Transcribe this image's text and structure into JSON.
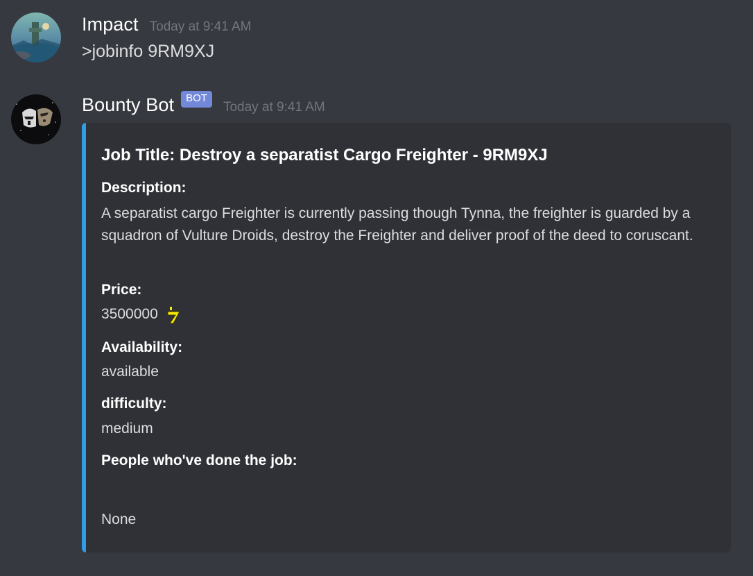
{
  "messages": [
    {
      "username": "Impact",
      "timestamp": "Today at 9:41 AM",
      "text": ">jobinfo 9RM9XJ",
      "avatar_icon": "landscape-avatar-icon"
    },
    {
      "username": "Bounty Bot",
      "bot_tag": "BOT",
      "timestamp": "Today at 9:41 AM",
      "avatar_icon": "clone-trooper-avatar-icon",
      "embed": {
        "accent_color": "#2f9de8",
        "title": "Job Title: Destroy a separatist Cargo Freighter - 9RM9XJ",
        "fields": [
          {
            "name": "Description:",
            "value": "A separatist cargo Freighter is currently passing though Tynna, the freighter is guarded by a squadron of Vulture Droids, destroy the Freighter and deliver proof of the deed to coruscant."
          },
          {
            "name": "Price:",
            "value": "3500000",
            "icon": "credit-icon"
          },
          {
            "name": "Availability:",
            "value": "available"
          },
          {
            "name": "difficulty:",
            "value": "medium"
          },
          {
            "name": "People who've done the job:",
            "value": "None"
          }
        ]
      }
    }
  ],
  "colors": {
    "background": "#36393f",
    "embed_background": "#2f3136",
    "bot_tag": "#7289da",
    "timestamp": "#72767d"
  }
}
